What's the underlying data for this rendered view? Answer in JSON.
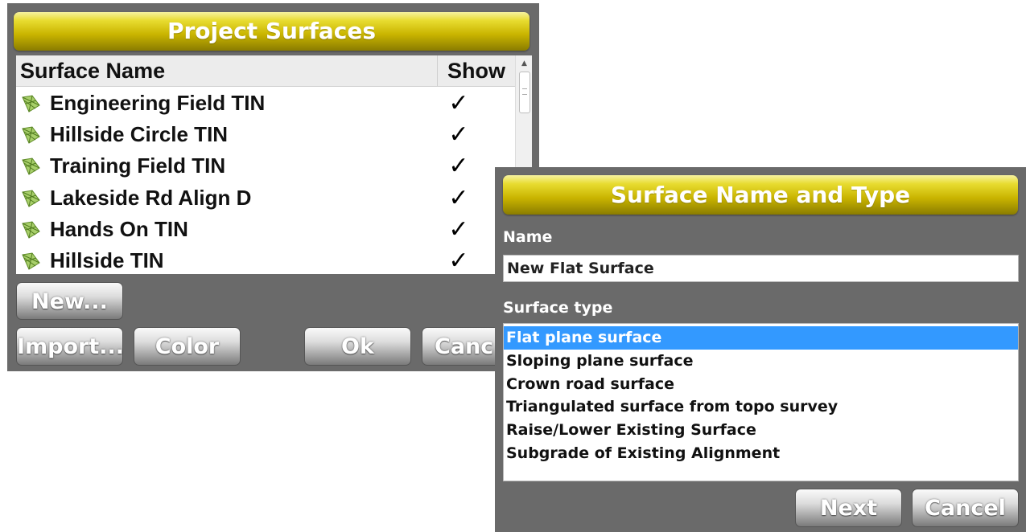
{
  "project_surfaces": {
    "title": "Project Surfaces",
    "columns": {
      "name": "Surface Name",
      "show": "Show"
    },
    "rows": [
      {
        "name": "Engineering Field TIN",
        "show": "✓"
      },
      {
        "name": "Hillside Circle TIN",
        "show": "✓"
      },
      {
        "name": "Training Field TIN",
        "show": "✓"
      },
      {
        "name": "Lakeside Rd Align D",
        "show": "✓"
      },
      {
        "name": "Hands On TIN",
        "show": "✓"
      },
      {
        "name": "Hillside TIN",
        "show": "✓"
      }
    ],
    "buttons": {
      "new": "New...",
      "import": "Import...",
      "color": "Color",
      "ok": "Ok",
      "cancel": "Canc"
    },
    "icon": "surface-tin-icon"
  },
  "surface_name_type": {
    "title": "Surface Name and Type",
    "name_label": "Name",
    "name_value": "New Flat Surface",
    "type_label": "Surface type",
    "types": [
      "Flat plane surface",
      "Sloping plane surface",
      "Crown road surface",
      "Triangulated surface from topo survey",
      "Raise/Lower Existing Surface",
      "Subgrade of Existing Alignment"
    ],
    "selected_type": "Flat plane surface",
    "buttons": {
      "next": "Next",
      "cancel": "Cancel"
    }
  },
  "colors": {
    "dialog_bg": "#6a6a6a",
    "title_gradient": "#c9b400",
    "selection": "#3399ff"
  }
}
